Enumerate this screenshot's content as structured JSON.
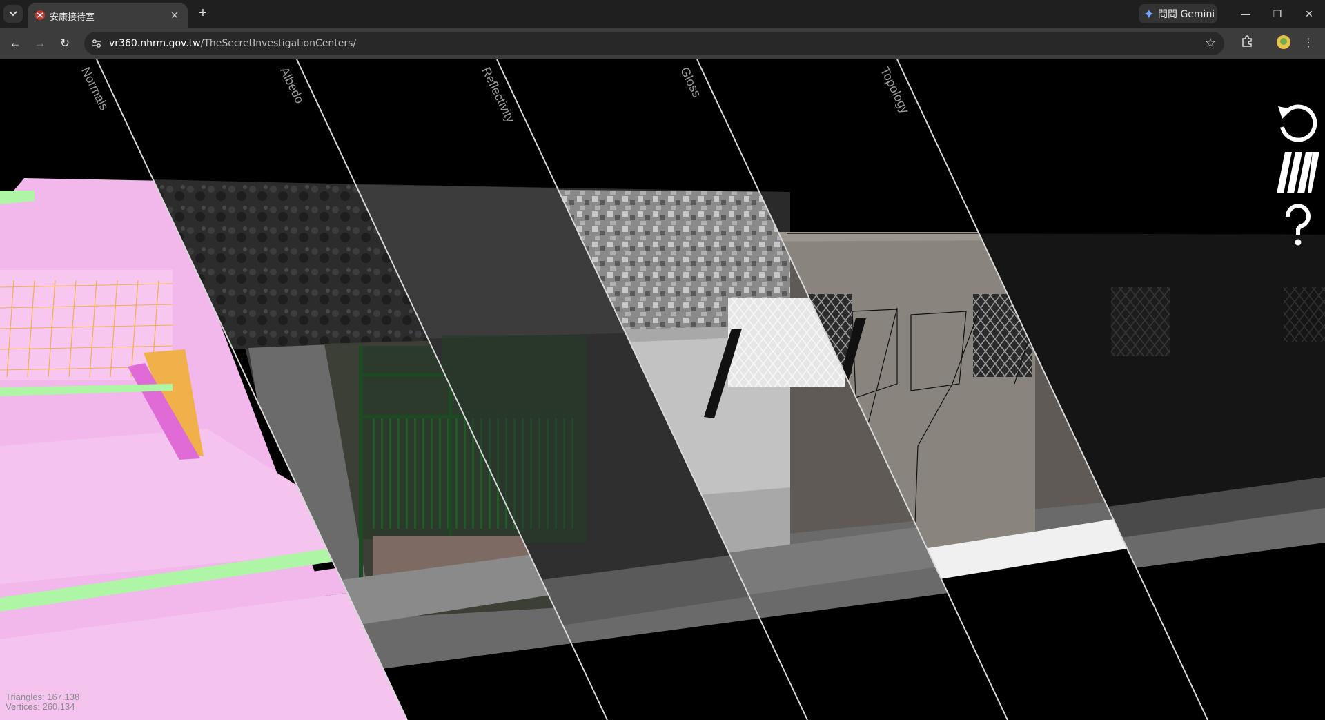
{
  "browser": {
    "tab_title": "安康接待室",
    "url_host": "vr360.nhrm.gov.tw",
    "url_path": "/TheSecretInvestigationCenters/",
    "gemini_label": "問問 Gemini"
  },
  "viewer": {
    "layer_labels": [
      "Normals",
      "Albedo",
      "Reflectivity",
      "Gloss",
      "Topology"
    ],
    "stats": {
      "triangles": "Triangles: 167,138",
      "vertices": "Vertices: 260,134"
    },
    "controls": {
      "reset_icon": "reset-rotate-icon",
      "layers_icon": "layers-slash-icon",
      "help_icon": "help-question-icon"
    }
  },
  "colors": {
    "normals_pink": "#f2b8ec",
    "normals_green": "#aef5a6",
    "normals_orange": "#f0b04a",
    "wall_gray": "#8a847e",
    "window_frame_green": "#1d4a22"
  }
}
